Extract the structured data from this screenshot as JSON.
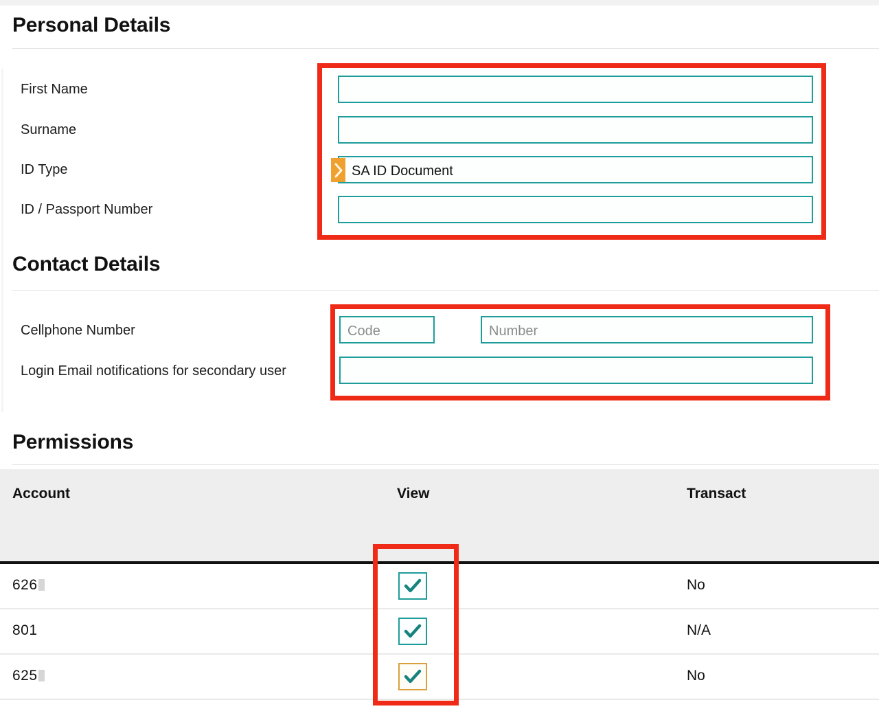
{
  "colors": {
    "field_border": "#1d9c9a",
    "annotation": "#ef2b18",
    "marker": "#f0a02e",
    "focus_border": "#d9a040",
    "header_bg": "#eeeeee",
    "check": "#17837f"
  },
  "personal_details": {
    "title": "Personal Details",
    "fields": [
      {
        "label": "First Name",
        "value": "",
        "placeholder": ""
      },
      {
        "label": "Surname",
        "value": "",
        "placeholder": ""
      },
      {
        "label": "ID Type",
        "value": "SA ID Document",
        "placeholder": "",
        "marker_icon": "chevron-right-icon"
      },
      {
        "label": "ID / Passport Number",
        "value": "",
        "placeholder": ""
      }
    ]
  },
  "contact_details": {
    "title": "Contact Details",
    "cellphone": {
      "label": "Cellphone Number",
      "code": {
        "value": "",
        "placeholder": "Code"
      },
      "number": {
        "value": "",
        "placeholder": "Number"
      }
    },
    "login_email": {
      "label": "Login Email notifications for secondary user",
      "value": "",
      "placeholder": ""
    }
  },
  "permissions": {
    "title": "Permissions",
    "columns": [
      "Account",
      "View",
      "Transact"
    ],
    "rows": [
      {
        "account": "626",
        "account_redacted": true,
        "view_checked": true,
        "view_focused": false,
        "transact": "No"
      },
      {
        "account": "801",
        "account_redacted": false,
        "view_checked": true,
        "view_focused": false,
        "transact": "N/A"
      },
      {
        "account": "625",
        "account_redacted": true,
        "view_checked": true,
        "view_focused": true,
        "transact": "No"
      }
    ]
  }
}
